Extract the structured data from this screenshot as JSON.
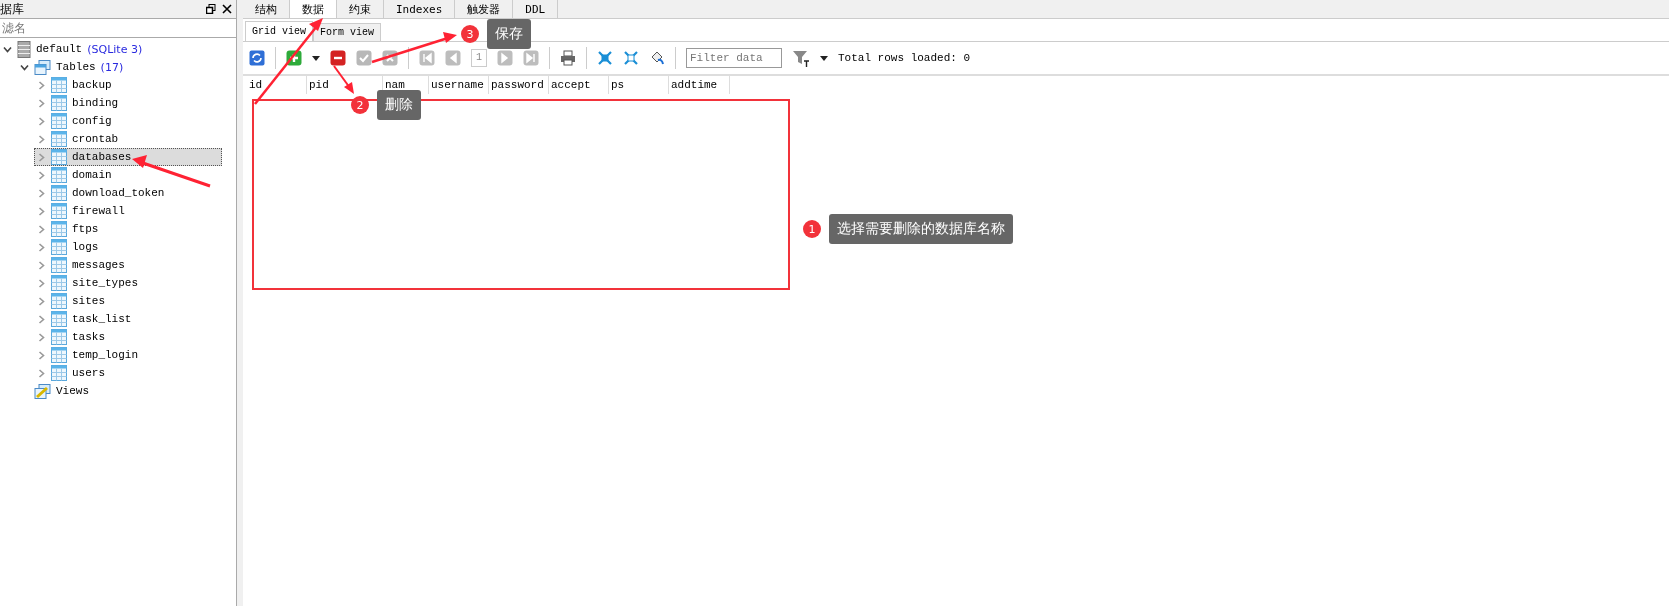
{
  "left_panel": {
    "title": "据库",
    "filter": {
      "placeholder": "滤名"
    },
    "tree": [
      {
        "label": "default",
        "note": "(SQLite 3)",
        "kind": "database",
        "expanded": true,
        "children": [
          {
            "label": "Tables",
            "note": "(17)",
            "kind": "tables",
            "expanded": true,
            "children": [
              {
                "label": "backup",
                "kind": "table",
                "expanded": false,
                "selected": false
              },
              {
                "label": "binding",
                "kind": "table",
                "expanded": false,
                "selected": false
              },
              {
                "label": "config",
                "kind": "table",
                "expanded": false,
                "selected": false
              },
              {
                "label": "crontab",
                "kind": "table",
                "expanded": false,
                "selected": false
              },
              {
                "label": "databases",
                "kind": "table",
                "expanded": false,
                "selected": true
              },
              {
                "label": "domain",
                "kind": "table",
                "expanded": false,
                "selected": false
              },
              {
                "label": "download_token",
                "kind": "table",
                "expanded": false,
                "selected": false
              },
              {
                "label": "firewall",
                "kind": "table",
                "expanded": false,
                "selected": false
              },
              {
                "label": "ftps",
                "kind": "table",
                "expanded": false,
                "selected": false
              },
              {
                "label": "logs",
                "kind": "table",
                "expanded": false,
                "selected": false
              },
              {
                "label": "messages",
                "kind": "table",
                "expanded": false,
                "selected": false
              },
              {
                "label": "site_types",
                "kind": "table",
                "expanded": false,
                "selected": false
              },
              {
                "label": "sites",
                "kind": "table",
                "expanded": false,
                "selected": false
              },
              {
                "label": "task_list",
                "kind": "table",
                "expanded": false,
                "selected": false
              },
              {
                "label": "tasks",
                "kind": "table",
                "expanded": false,
                "selected": false
              },
              {
                "label": "temp_login",
                "kind": "table",
                "expanded": false,
                "selected": false
              },
              {
                "label": "users",
                "kind": "table",
                "expanded": false,
                "selected": false
              }
            ]
          },
          {
            "label": "Views",
            "kind": "views"
          }
        ]
      }
    ]
  },
  "tabs": [
    {
      "label": "结构",
      "selected": false
    },
    {
      "label": "数据",
      "selected": true
    },
    {
      "label": "约束",
      "selected": false
    },
    {
      "label": "Indexes",
      "selected": false
    },
    {
      "label": "触发器",
      "selected": false
    },
    {
      "label": "DDL",
      "selected": false
    }
  ],
  "view_tabs": [
    {
      "label": "Grid view",
      "selected": true
    },
    {
      "label": "Form view",
      "selected": false
    }
  ],
  "toolbar": [
    {
      "kind": "refresh",
      "disabled": false
    },
    {
      "kind": "sep"
    },
    {
      "kind": "add",
      "disabled": false
    },
    {
      "kind": "caret",
      "disabled": false
    },
    {
      "kind": "delete",
      "disabled": false
    },
    {
      "kind": "commit",
      "disabled": true
    },
    {
      "kind": "rollback",
      "disabled": true
    },
    {
      "kind": "sep"
    },
    {
      "kind": "first",
      "disabled": true
    },
    {
      "kind": "prev",
      "disabled": true
    },
    {
      "kind": "page",
      "text": "1",
      "disabled": true
    },
    {
      "kind": "next",
      "disabled": true
    },
    {
      "kind": "last",
      "disabled": true
    },
    {
      "kind": "sep"
    },
    {
      "kind": "print",
      "disabled": false
    },
    {
      "kind": "sep"
    },
    {
      "kind": "collapse",
      "disabled": false
    },
    {
      "kind": "expand",
      "disabled": false
    },
    {
      "kind": "paint",
      "disabled": false
    },
    {
      "kind": "sep"
    },
    {
      "kind": "filter_field",
      "placeholder": "Filter data"
    },
    {
      "kind": "funnel",
      "disabled": false
    },
    {
      "kind": "caret",
      "disabled": false
    },
    {
      "kind": "status",
      "text": "Total rows loaded: 0"
    }
  ],
  "table": {
    "columns": [
      "id",
      "pid",
      "nam",
      "username",
      "password",
      "accept",
      "ps",
      "addtime"
    ]
  },
  "annotations": [
    {
      "number": "1",
      "text": "选择需要删除的数据库名称"
    },
    {
      "number": "2",
      "text": "删除"
    },
    {
      "number": "3",
      "text": "保存"
    }
  ]
}
